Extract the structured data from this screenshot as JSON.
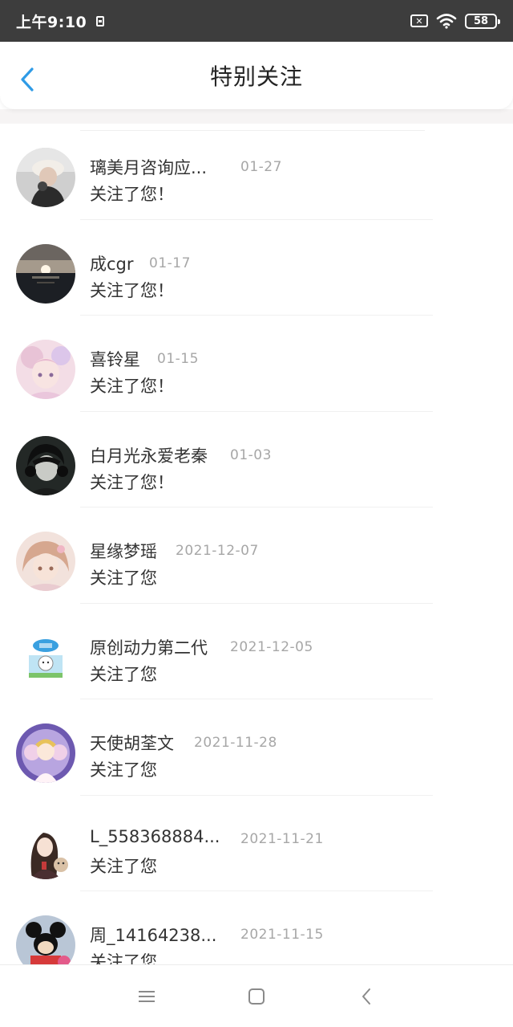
{
  "statusbar": {
    "time": "上午9:10",
    "battery": "58"
  },
  "header": {
    "title": "特别关注"
  },
  "list": [
    {
      "name": "璃美月咨询应...",
      "date": "01-27",
      "message": "关注了您！"
    },
    {
      "name": "成cgr",
      "date": "01-17",
      "message": "关注了您！"
    },
    {
      "name": "喜铃星",
      "date": "01-15",
      "message": "关注了您！"
    },
    {
      "name": "白月光永爱老秦",
      "date": "01-03",
      "message": "关注了您！"
    },
    {
      "name": "星缘梦瑶",
      "date": "2021-12-07",
      "message": "关注了您"
    },
    {
      "name": "原创动力第二代",
      "date": "2021-12-05",
      "message": "关注了您"
    },
    {
      "name": "天使胡荃文",
      "date": "2021-11-28",
      "message": "关注了您"
    },
    {
      "name": "L_558368884...",
      "date": "2021-11-21",
      "message": "关注了您"
    },
    {
      "name": "周_14164238...",
      "date": "2021-11-15",
      "message": "关注了您"
    }
  ],
  "icons": {
    "back": "back-chevron-icon",
    "nav_menu": "menu-icon",
    "nav_home": "home-square-icon",
    "nav_back": "back-triangle-icon",
    "wifi": "wifi-icon"
  },
  "colors": {
    "accent": "#2f9be6",
    "statusbar": "#3d3d3d",
    "date": "#a7a7a7"
  }
}
